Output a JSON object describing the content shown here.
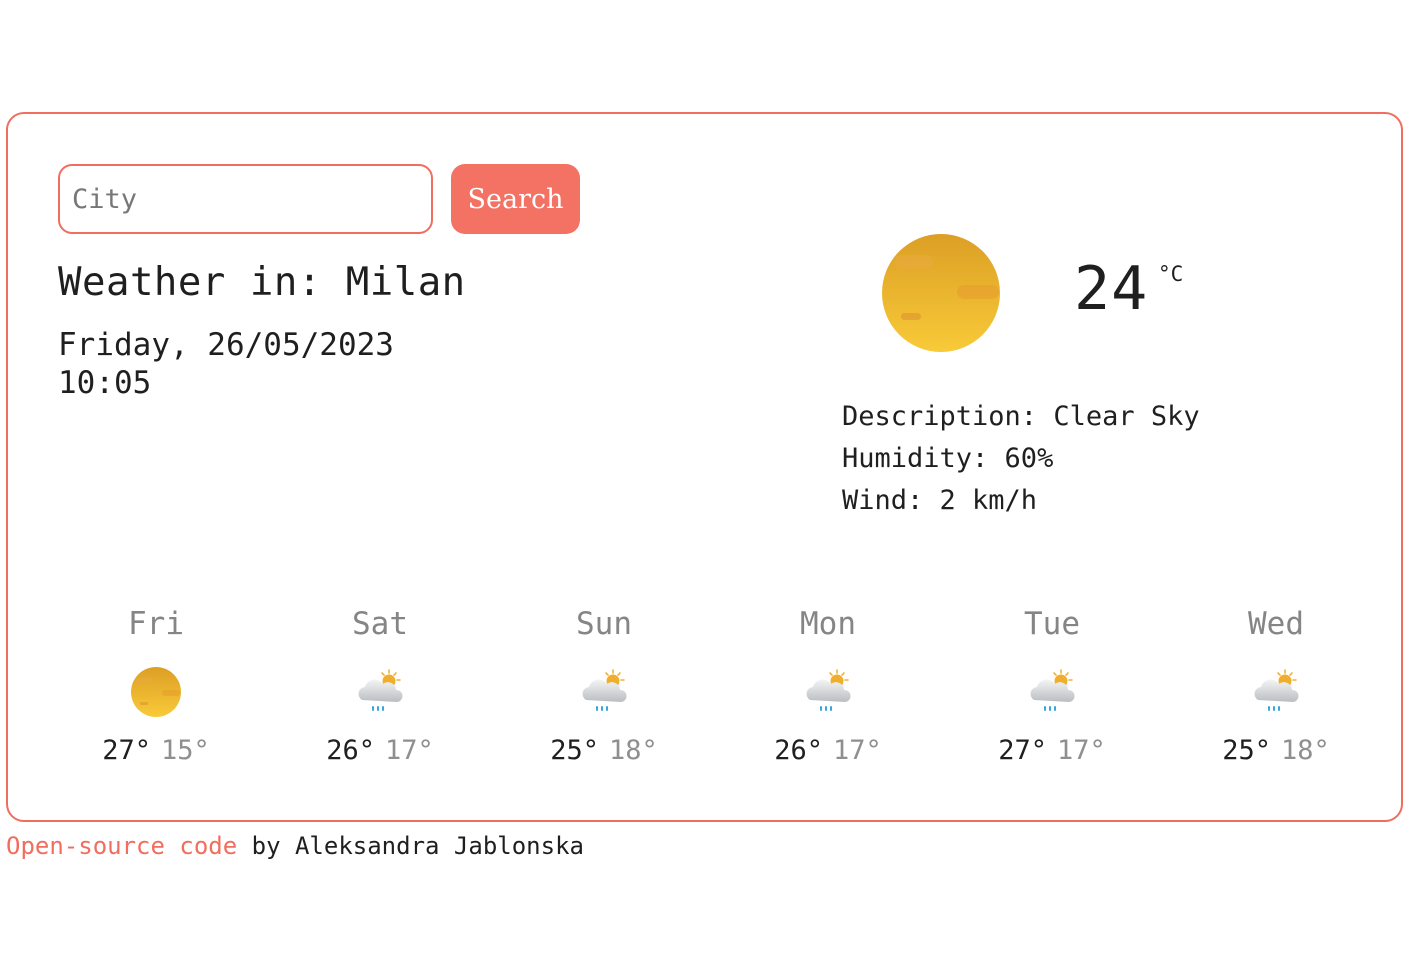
{
  "search": {
    "placeholder": "City",
    "button_label": "Search"
  },
  "current": {
    "title": "Weather in: Milan",
    "date": "Friday, 26/05/2023",
    "time": "10:05",
    "icon": "sun-icon",
    "temperature": "24",
    "unit": "°C",
    "description": "Description: Clear Sky",
    "humidity": "Humidity: 60%",
    "wind": "Wind: 2 km/h"
  },
  "forecast": [
    {
      "day": "Fri",
      "icon": "sun-icon",
      "max": "27°",
      "min": "15°"
    },
    {
      "day": "Sat",
      "icon": "rain-cloud-sun-icon",
      "max": "26°",
      "min": "17°"
    },
    {
      "day": "Sun",
      "icon": "rain-cloud-sun-icon",
      "max": "25°",
      "min": "18°"
    },
    {
      "day": "Mon",
      "icon": "rain-cloud-sun-icon",
      "max": "26°",
      "min": "17°"
    },
    {
      "day": "Tue",
      "icon": "rain-cloud-sun-icon",
      "max": "27°",
      "min": "17°"
    },
    {
      "day": "Wed",
      "icon": "rain-cloud-sun-icon",
      "max": "25°",
      "min": "18°"
    }
  ],
  "footer": {
    "link_text": "Open-source code",
    "suffix": " by Aleksandra Jablonska"
  },
  "colors": {
    "accent": "#f06e5f",
    "button": "#f47264",
    "sun_top": "#e2a42c",
    "sun_bottom": "#f7c737",
    "muted_text": "#858585"
  }
}
